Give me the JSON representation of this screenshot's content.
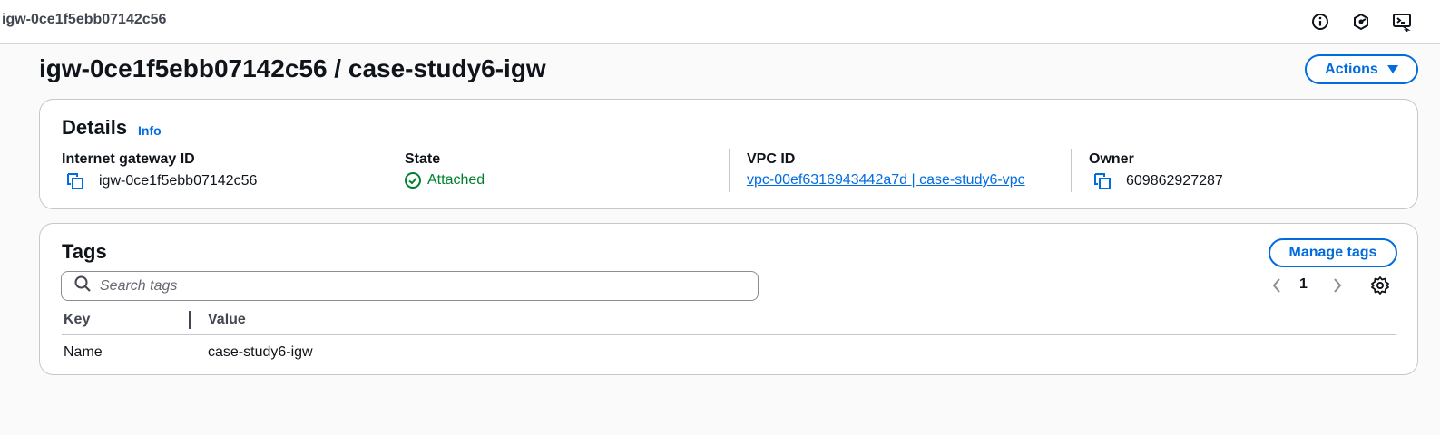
{
  "topbar": {
    "title": "igw-0ce1f5ebb07142c56",
    "icons": [
      "info-circle-icon",
      "shield-icon",
      "cloudshell-icon"
    ]
  },
  "page": {
    "title": "igw-0ce1f5ebb07142c56 / case-study6-igw",
    "actions_label": "Actions"
  },
  "details": {
    "heading": "Details",
    "info_label": "Info",
    "fields": {
      "igw_id": {
        "label": "Internet gateway ID",
        "value": "igw-0ce1f5ebb07142c56"
      },
      "state": {
        "label": "State",
        "value": "Attached"
      },
      "vpc": {
        "label": "VPC ID",
        "value": "vpc-00ef6316943442a7d | case-study6-vpc"
      },
      "owner": {
        "label": "Owner",
        "value": "609862927287"
      }
    }
  },
  "tags": {
    "heading": "Tags",
    "manage_label": "Manage tags",
    "search_placeholder": "Search tags",
    "pager": {
      "current": "1"
    },
    "columns": {
      "key": "Key",
      "value": "Value"
    },
    "rows": [
      {
        "key": "Name",
        "value": "case-study6-igw"
      }
    ]
  },
  "colors": {
    "accent": "#006ce0",
    "success": "#00802f",
    "text": "#0f141a",
    "border": "#c6c6cd",
    "background": "#fafafa"
  }
}
